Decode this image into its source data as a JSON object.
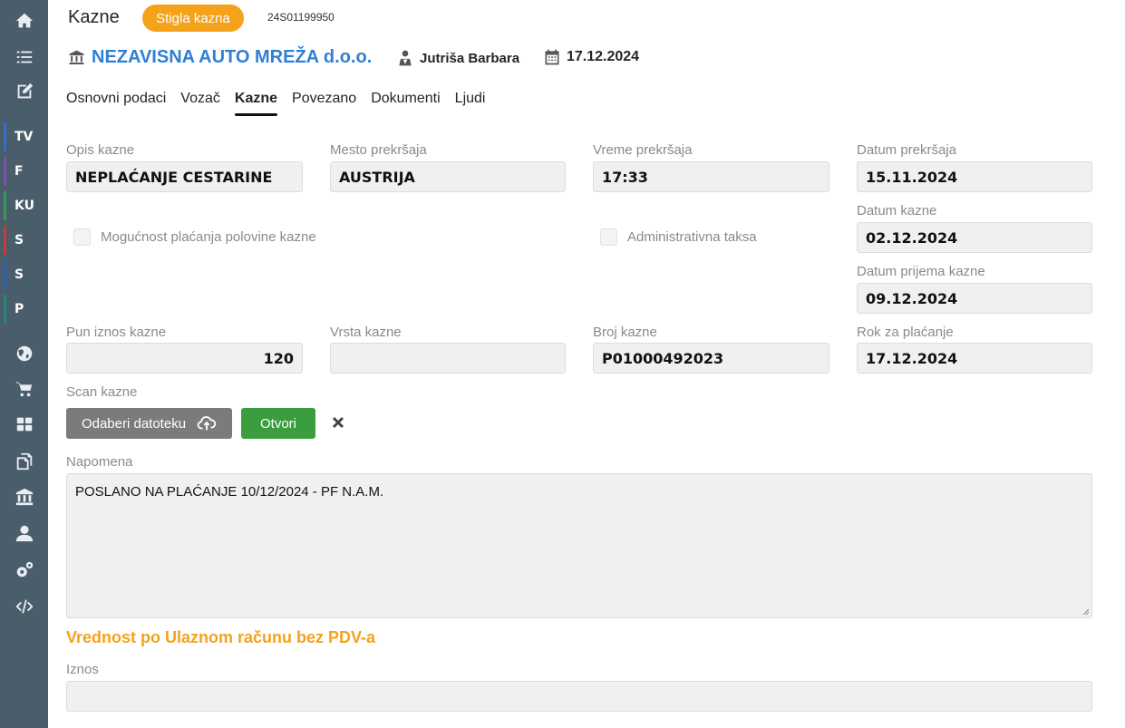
{
  "sidebar": {
    "icons": [
      "home-icon",
      "list-icon",
      "edit-icon"
    ],
    "modules": [
      {
        "label": "TV",
        "color": "#2f6fc7"
      },
      {
        "label": "F",
        "color": "#7a4fb6"
      },
      {
        "label": "KU",
        "color": "#2e9c55"
      },
      {
        "label": "S",
        "color": "#c63b3b"
      },
      {
        "label": "S",
        "color": "#2f5fb0"
      },
      {
        "label": "P",
        "color": "#1f8a7a"
      }
    ],
    "bottom_icons": [
      "globe-icon",
      "cart-icon",
      "dashboard-icon",
      "documents-icon",
      "bank-icon",
      "user-icon",
      "settings-icon",
      "code-icon"
    ]
  },
  "header": {
    "title": "Kazne",
    "status_badge": "Stigla kazna",
    "doc_number": "24S01199950",
    "company": "NEZAVISNA AUTO MREŽA d.o.o.",
    "person": "Jutriša Barbara",
    "date": "17.12.2024"
  },
  "tabs": [
    {
      "label": "Osnovni podaci",
      "active": false
    },
    {
      "label": "Vozač",
      "active": false
    },
    {
      "label": "Kazne",
      "active": true
    },
    {
      "label": "Povezano",
      "active": false
    },
    {
      "label": "Dokumenti",
      "active": false
    },
    {
      "label": "Ljudi",
      "active": false
    }
  ],
  "form": {
    "opis_kazne": {
      "label": "Opis kazne",
      "value": "NEPLAĆANJE CESTARINE"
    },
    "mesto_prekrsaja": {
      "label": "Mesto prekršaja",
      "value": "AUSTRIJA"
    },
    "vreme_prekrsaja": {
      "label": "Vreme prekršaja",
      "value": "17:33"
    },
    "datum_prekrsaja": {
      "label": "Datum prekršaja",
      "value": "15.11.2024"
    },
    "polovina_kazne": {
      "label": "Mogućnost plaćanja polovine kazne",
      "checked": false
    },
    "administrativna_taksa": {
      "label": "Administrativna taksa",
      "checked": false
    },
    "datum_kazne": {
      "label": "Datum kazne",
      "value": "02.12.2024"
    },
    "datum_prijema": {
      "label": "Datum prijema kazne",
      "value": "09.12.2024"
    },
    "pun_iznos": {
      "label": "Pun iznos kazne",
      "value": "120"
    },
    "vrsta_kazne": {
      "label": "Vrsta kazne",
      "value": ""
    },
    "broj_kazne": {
      "label": "Broj kazne",
      "value": "P01000492023"
    },
    "rok_placanja": {
      "label": "Rok za plaćanje",
      "value": "17.12.2024"
    },
    "scan_kazne": {
      "label": "Scan kazne",
      "choose_button": "Odaberi datoteku",
      "open_button": "Otvori"
    },
    "napomena": {
      "label": "Napomena",
      "value": "POSLANO NA PLAĆANJE 10/12/2024 - PF N.A.M."
    }
  },
  "section": {
    "title": "Vrednost po Ulaznom računu bez PDV-a",
    "iznos": {
      "label": "Iznos",
      "value": ""
    }
  },
  "colors": {
    "accent": "#f5a21b",
    "link": "#2f7fd6",
    "open_button": "#3a9e3f",
    "sidebar": "#4a5d6b"
  }
}
